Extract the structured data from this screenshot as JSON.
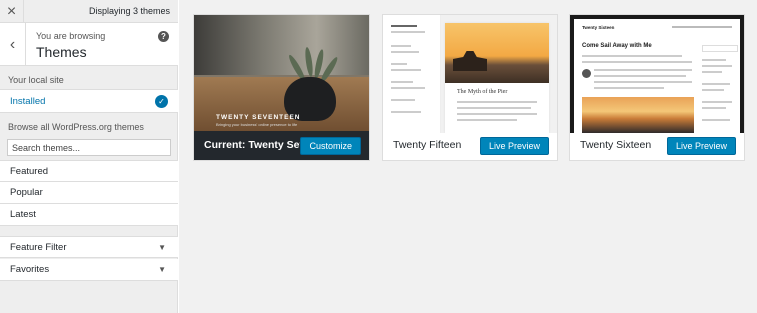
{
  "topbar": {
    "close_icon": "×",
    "displaying": "Displaying 3 themes"
  },
  "browsing": {
    "back_icon": "‹",
    "label": "You are browsing",
    "title": "Themes",
    "help_icon": "?"
  },
  "local": {
    "label": "Your local site",
    "installed": "Installed",
    "check_icon": "✓"
  },
  "browse": {
    "label": "Browse all WordPress.org themes",
    "search_placeholder": "Search themes...",
    "items": [
      "Featured",
      "Popular",
      "Latest"
    ]
  },
  "filters": {
    "items": [
      "Feature Filter",
      "Favorites"
    ],
    "caret": "▼"
  },
  "themes": [
    {
      "name": "Current: Twenty Seventeen",
      "action": "Customize",
      "screenshot_title": "TWENTY SEVENTEEN",
      "screenshot_sub": "Bringing your business' online presence to life"
    },
    {
      "name": "Twenty Fifteen",
      "action": "Live Preview",
      "screenshot_title": "The Myth of the Pier"
    },
    {
      "name": "Twenty Sixteen",
      "action": "Live Preview",
      "screenshot_site": "Twenty Sixteen",
      "screenshot_title": "Come Sail Away with Me"
    }
  ],
  "colors": {
    "accent": "#0073aa",
    "button": "#0085ba",
    "current_bar": "#23282d"
  }
}
